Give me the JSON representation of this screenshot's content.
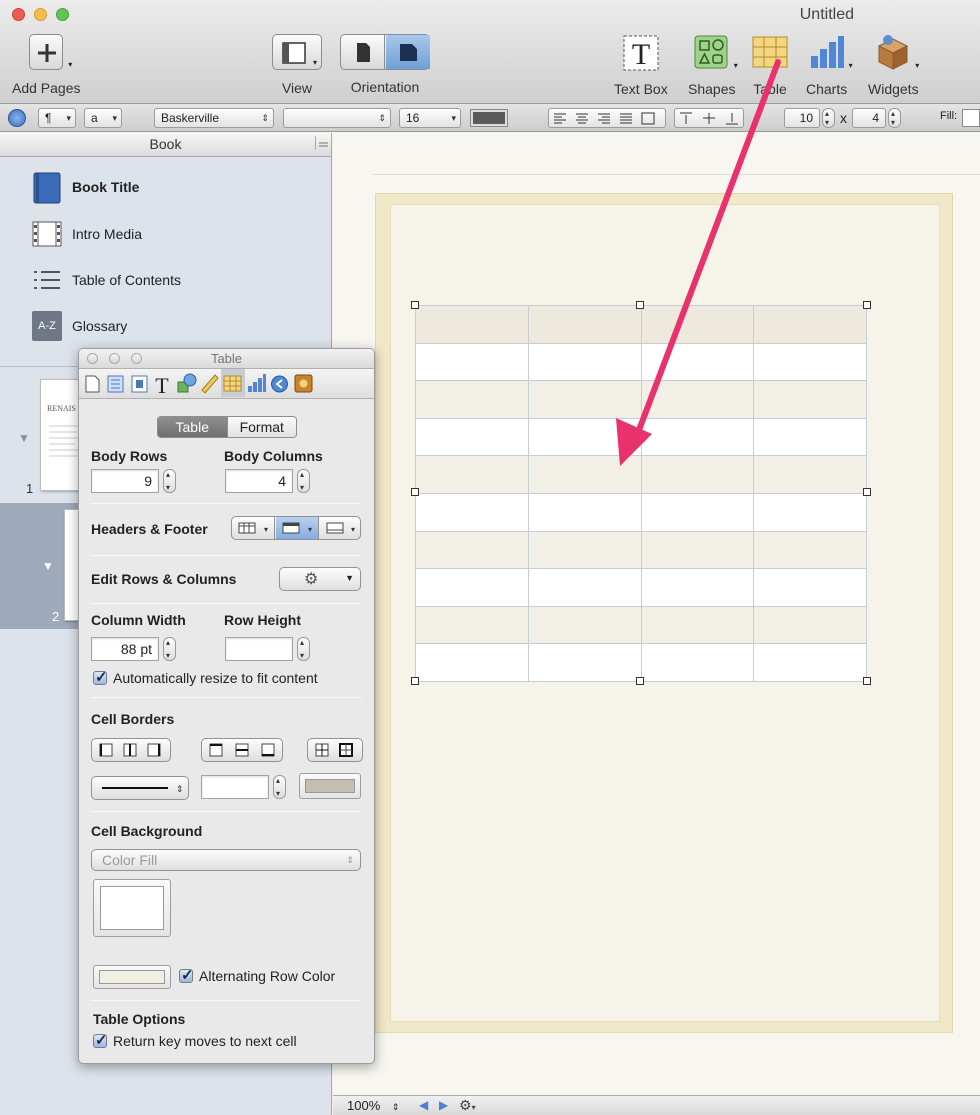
{
  "window": {
    "title": "Untitled"
  },
  "toolbar": {
    "add_pages": "Add Pages",
    "view": "View",
    "orientation": "Orientation",
    "text_box": "Text Box",
    "shapes": "Shapes",
    "table": "Table",
    "charts": "Charts",
    "widgets": "Widgets"
  },
  "formatbar": {
    "paragraph_style": "¶",
    "char_style": "a",
    "font_family": "Baskerville",
    "font_typeface": "",
    "font_size": "16",
    "columns": "10",
    "times": "x",
    "rows": "4",
    "fill_label": "Fill:"
  },
  "sidebar": {
    "header": "Book",
    "items": [
      {
        "label": "Book Title",
        "icon": "book-icon"
      },
      {
        "label": "Intro Media",
        "icon": "film-strip-icon"
      },
      {
        "label": "Table of Contents",
        "icon": "list-icon"
      },
      {
        "label": "Glossary",
        "icon": "a-z-icon"
      }
    ],
    "glossary_icon_text": "A-Z",
    "thumbnails": [
      {
        "number": "1",
        "preview_title": "RENAIS"
      },
      {
        "number": "2"
      }
    ]
  },
  "inspector": {
    "title": "Table",
    "tabs": [
      "document",
      "layout",
      "wrap",
      "text",
      "graphic",
      "metrics",
      "table",
      "chart",
      "link",
      "quicktime"
    ],
    "segments": {
      "table": "Table",
      "format": "Format"
    },
    "body_rows_label": "Body Rows",
    "body_rows": "9",
    "body_columns_label": "Body Columns",
    "body_columns": "4",
    "headers_footer_label": "Headers & Footer",
    "edit_rows_columns_label": "Edit Rows & Columns",
    "column_width_label": "Column Width",
    "column_width": "88 pt",
    "row_height_label": "Row Height",
    "row_height": "",
    "auto_resize_label": "Automatically resize to fit content",
    "cell_borders_label": "Cell Borders",
    "border_width": "",
    "cell_background_label": "Cell Background",
    "color_fill": "Color Fill",
    "alternating_row_label": "Alternating Row Color",
    "table_options_label": "Table Options",
    "return_key_label": "Return key moves to next cell"
  },
  "statusbar": {
    "zoom": "100%"
  },
  "colors": {
    "accent_arrow": "#e8316d",
    "header_row": "#ede9dc",
    "alt_row": "#f1efe6",
    "page_frame": "#f1e8c8"
  }
}
